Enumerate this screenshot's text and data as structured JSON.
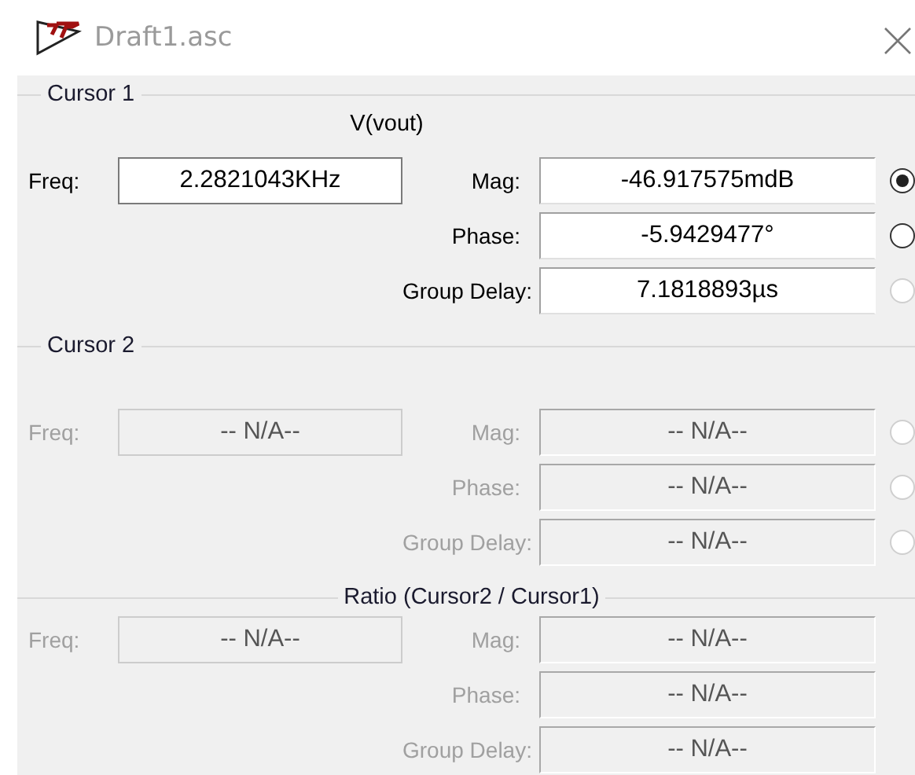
{
  "window": {
    "title": "Draft1.asc"
  },
  "sections": [
    {
      "kind": "cursor",
      "title": "Cursor 1",
      "trace": "V(vout)",
      "disabled": false,
      "freq": {
        "label": "Freq:",
        "value": "2.2821043KHz"
      },
      "rows": [
        {
          "label": "Mag:",
          "value": "-46.917575mdB",
          "radio": {
            "selected": true,
            "disabled": false
          }
        },
        {
          "label": "Phase:",
          "value": "-5.9429477°",
          "radio": {
            "selected": false,
            "disabled": false
          }
        },
        {
          "label": "Group Delay:",
          "value": "7.1818893µs",
          "radio": {
            "selected": false,
            "disabled": true
          }
        }
      ]
    },
    {
      "kind": "cursor",
      "title": "Cursor 2",
      "disabled": true,
      "freq": {
        "label": "Freq:",
        "value": "-- N/A--"
      },
      "rows": [
        {
          "label": "Mag:",
          "value": "-- N/A--",
          "radio": {
            "selected": false,
            "disabled": true
          }
        },
        {
          "label": "Phase:",
          "value": "-- N/A--",
          "radio": {
            "selected": false,
            "disabled": true
          }
        },
        {
          "label": "Group Delay:",
          "value": "-- N/A--",
          "radio": {
            "selected": false,
            "disabled": true
          }
        }
      ]
    },
    {
      "kind": "ratio",
      "title": "Ratio (Cursor2 / Cursor1)",
      "disabled": true,
      "freq": {
        "label": "Freq:",
        "value": "-- N/A--"
      },
      "rows": [
        {
          "label": "Mag:",
          "value": "-- N/A--"
        },
        {
          "label": "Phase:",
          "value": "-- N/A--"
        },
        {
          "label": "Group Delay:",
          "value": "-- N/A--"
        }
      ]
    }
  ]
}
